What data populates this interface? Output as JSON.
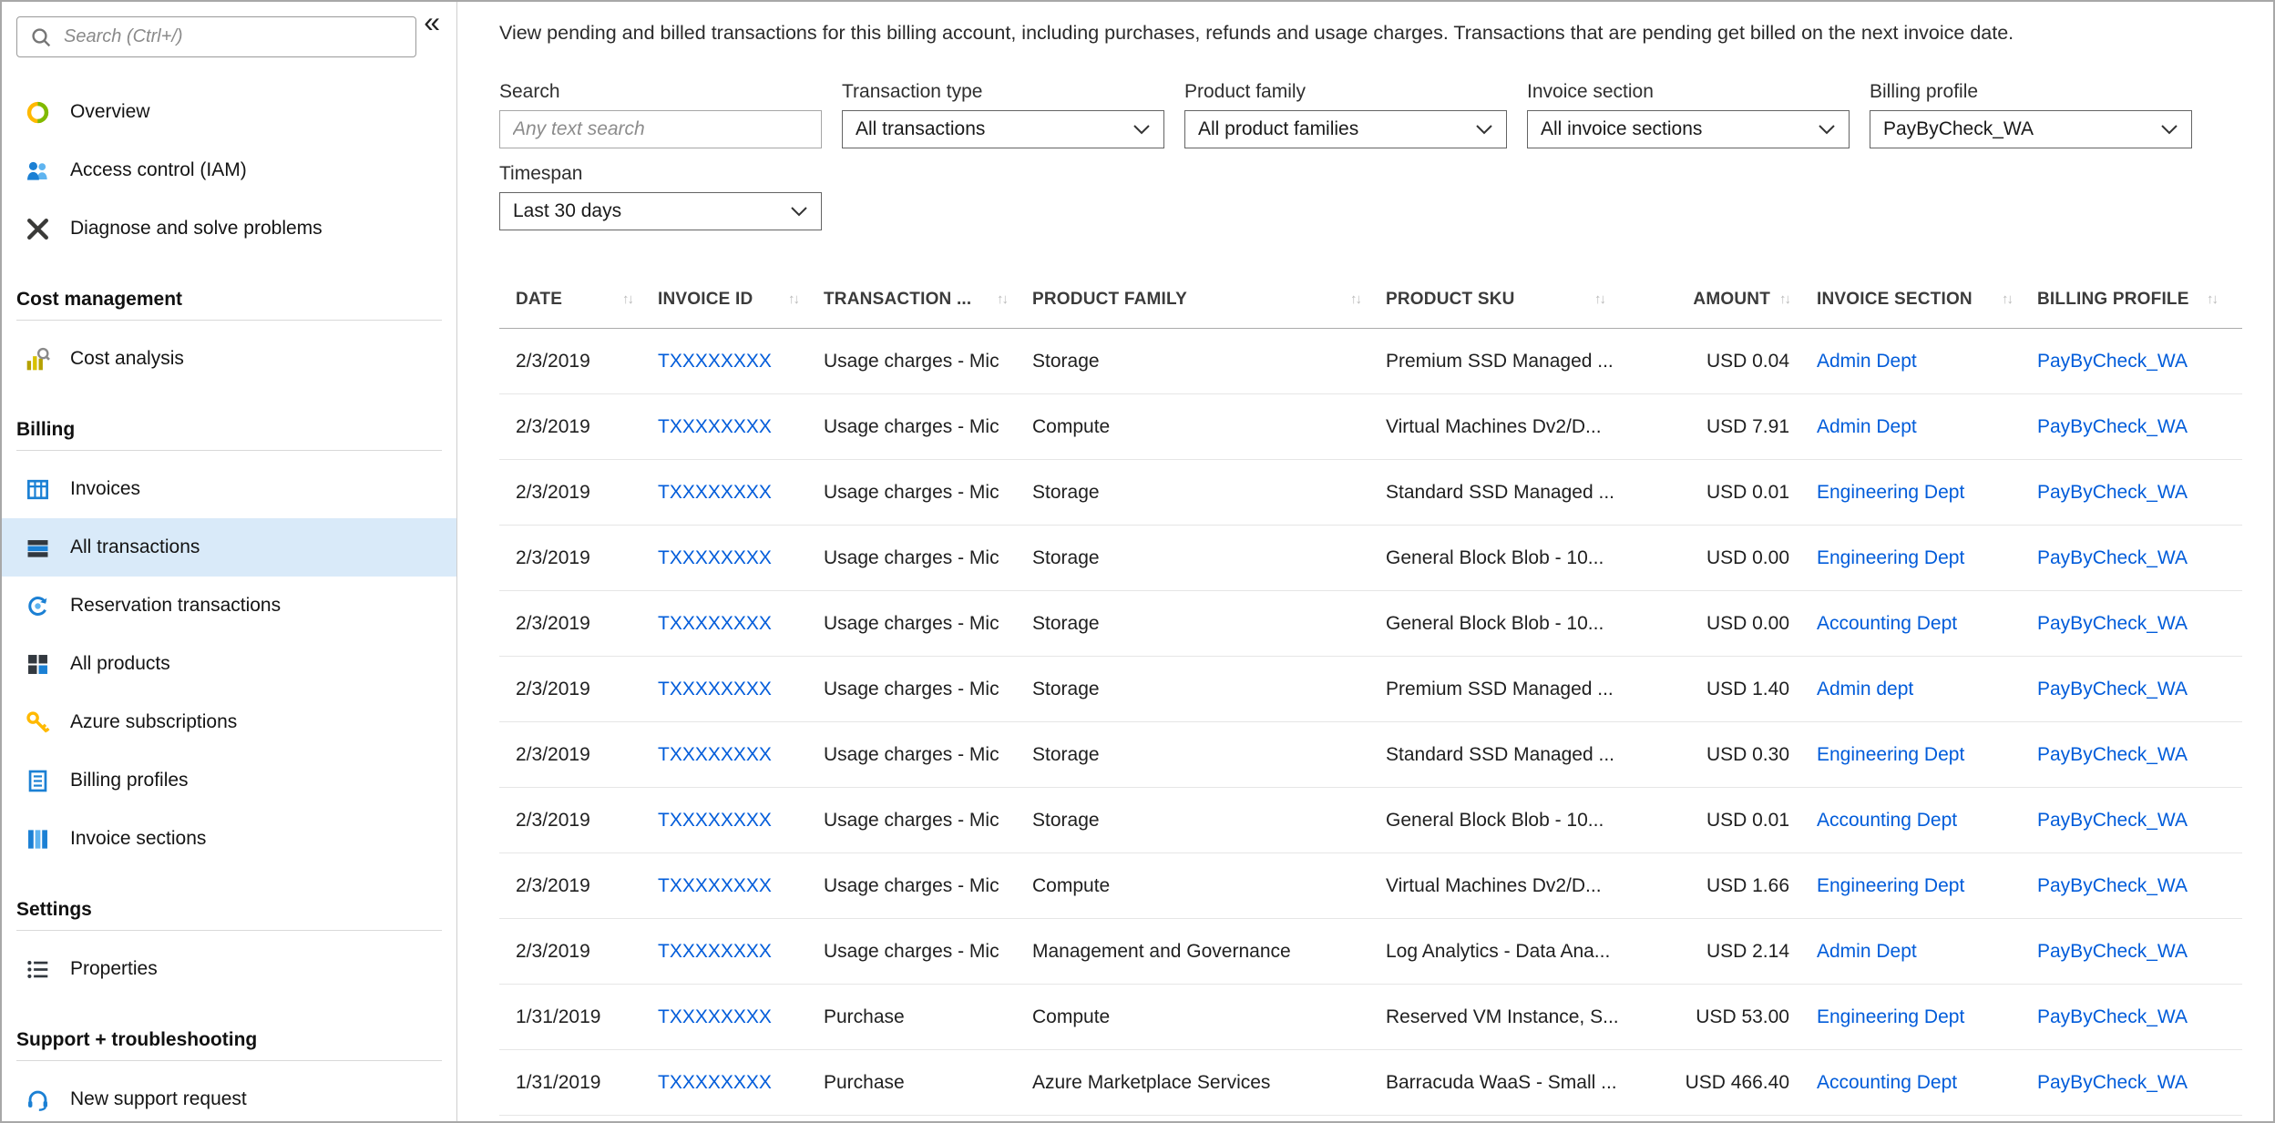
{
  "colors": {
    "accent_link": "#015cda",
    "selected_item_bg": "#d9eaf9"
  },
  "icons": {
    "sort": "↑↓",
    "collapse": "«"
  },
  "sidebar": {
    "search": {
      "placeholder": "Search (Ctrl+/)"
    },
    "items": [
      {
        "label": "Overview"
      },
      {
        "label": "Access control (IAM)"
      },
      {
        "label": "Diagnose and solve problems"
      }
    ],
    "sections": [
      {
        "title": "Cost management",
        "items": [
          {
            "label": "Cost analysis"
          }
        ]
      },
      {
        "title": "Billing",
        "items": [
          {
            "label": "Invoices"
          },
          {
            "label": "All transactions",
            "selected": true
          },
          {
            "label": "Reservation transactions"
          },
          {
            "label": "All products"
          },
          {
            "label": "Azure subscriptions"
          },
          {
            "label": "Billing profiles"
          },
          {
            "label": "Invoice sections"
          }
        ]
      },
      {
        "title": "Settings",
        "items": [
          {
            "label": "Properties"
          }
        ]
      },
      {
        "title": "Support + troubleshooting",
        "items": [
          {
            "label": "New support request"
          }
        ]
      }
    ]
  },
  "main": {
    "description": "View pending and billed transactions for this billing account, including purchases, refunds and usage charges. Transactions that are pending get billed on the next invoice date.",
    "filters": {
      "search": {
        "label": "Search",
        "placeholder": "Any text search"
      },
      "transaction_type": {
        "label": "Transaction type",
        "value": "All transactions"
      },
      "product_family": {
        "label": "Product family",
        "value": "All product families"
      },
      "invoice_section": {
        "label": "Invoice section",
        "value": "All invoice sections"
      },
      "billing_profile": {
        "label": "Billing profile",
        "value": "PayByCheck_WA"
      },
      "timespan": {
        "label": "Timespan",
        "value": "Last 30 days"
      }
    },
    "table": {
      "columns": [
        "DATE",
        "INVOICE ID",
        "TRANSACTION ...",
        "PRODUCT FAMILY",
        "PRODUCT SKU",
        "AMOUNT",
        "INVOICE SECTION",
        "BILLING PROFILE"
      ],
      "rows": [
        {
          "date": "2/3/2019",
          "invoice_id": "TXXXXXXXX",
          "transaction_type": "Usage charges - Mic",
          "product_family": "Storage",
          "product_sku": "Premium SSD Managed ...",
          "amount": "USD 0.04",
          "invoice_section": "Admin Dept",
          "billing_profile": "PayByCheck_WA"
        },
        {
          "date": "2/3/2019",
          "invoice_id": "TXXXXXXXX",
          "transaction_type": "Usage charges - Mic",
          "product_family": "Compute",
          "product_sku": "Virtual Machines Dv2/D...",
          "amount": "USD 7.91",
          "invoice_section": "Admin Dept",
          "billing_profile": "PayByCheck_WA"
        },
        {
          "date": "2/3/2019",
          "invoice_id": "TXXXXXXXX",
          "transaction_type": "Usage charges - Mic",
          "product_family": "Storage",
          "product_sku": "Standard SSD Managed ...",
          "amount": "USD 0.01",
          "invoice_section": "Engineering Dept",
          "billing_profile": "PayByCheck_WA"
        },
        {
          "date": "2/3/2019",
          "invoice_id": "TXXXXXXXX",
          "transaction_type": "Usage charges - Mic",
          "product_family": "Storage",
          "product_sku": "General Block Blob - 10...",
          "amount": "USD 0.00",
          "invoice_section": "Engineering Dept",
          "billing_profile": "PayByCheck_WA"
        },
        {
          "date": "2/3/2019",
          "invoice_id": "TXXXXXXXX",
          "transaction_type": "Usage charges - Mic",
          "product_family": "Storage",
          "product_sku": "General Block Blob - 10...",
          "amount": "USD 0.00",
          "invoice_section": "Accounting Dept",
          "billing_profile": "PayByCheck_WA"
        },
        {
          "date": "2/3/2019",
          "invoice_id": "TXXXXXXXX",
          "transaction_type": "Usage charges - Mic",
          "product_family": "Storage",
          "product_sku": "Premium SSD Managed ...",
          "amount": "USD 1.40",
          "invoice_section": "Admin dept",
          "billing_profile": "PayByCheck_WA"
        },
        {
          "date": "2/3/2019",
          "invoice_id": "TXXXXXXXX",
          "transaction_type": "Usage charges - Mic",
          "product_family": "Storage",
          "product_sku": "Standard SSD Managed ...",
          "amount": "USD 0.30",
          "invoice_section": "Engineering Dept",
          "billing_profile": "PayByCheck_WA"
        },
        {
          "date": "2/3/2019",
          "invoice_id": "TXXXXXXXX",
          "transaction_type": "Usage charges - Mic",
          "product_family": "Storage",
          "product_sku": "General Block Blob - 10...",
          "amount": "USD 0.01",
          "invoice_section": "Accounting Dept",
          "billing_profile": "PayByCheck_WA"
        },
        {
          "date": "2/3/2019",
          "invoice_id": "TXXXXXXXX",
          "transaction_type": "Usage charges - Mic",
          "product_family": "Compute",
          "product_sku": "Virtual Machines Dv2/D...",
          "amount": "USD 1.66",
          "invoice_section": "Engineering Dept",
          "billing_profile": "PayByCheck_WA"
        },
        {
          "date": "2/3/2019",
          "invoice_id": "TXXXXXXXX",
          "transaction_type": "Usage charges - Mic",
          "product_family": "Management and Governance",
          "product_sku": "Log Analytics - Data Ana...",
          "amount": "USD 2.14",
          "invoice_section": "Admin Dept",
          "billing_profile": "PayByCheck_WA"
        },
        {
          "date": "1/31/2019",
          "invoice_id": "TXXXXXXXX",
          "transaction_type": "Purchase",
          "product_family": "Compute",
          "product_sku": "Reserved VM Instance, S...",
          "amount": "USD 53.00",
          "invoice_section": "Engineering Dept",
          "billing_profile": "PayByCheck_WA"
        },
        {
          "date": "1/31/2019",
          "invoice_id": "TXXXXXXXX",
          "transaction_type": "Purchase",
          "product_family": "Azure Marketplace Services",
          "product_sku": "Barracuda WaaS - Small ...",
          "amount": "USD 466.40",
          "invoice_section": "Accounting Dept",
          "billing_profile": "PayByCheck_WA"
        }
      ]
    }
  }
}
